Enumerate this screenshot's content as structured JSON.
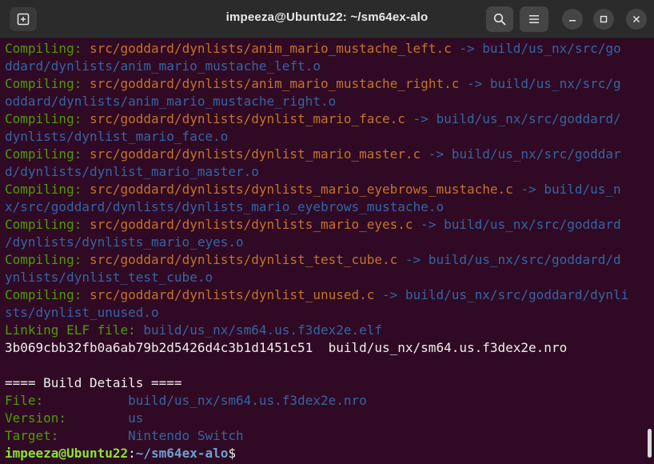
{
  "window": {
    "title": "impeeza@Ubuntu22: ~/sm64ex-alo",
    "icons": {
      "new_tab": "new-tab-icon",
      "search": "search-icon",
      "menu": "hamburger-menu-icon",
      "minimize": "minimize-icon",
      "maximize": "maximize-icon",
      "close": "close-icon"
    }
  },
  "colors": {
    "background": "#300a24",
    "green": "#4e9a06",
    "orange": "#c4732a",
    "blue": "#3465a4",
    "text": "#eeeeec"
  },
  "compile": {
    "label": "Compiling: ",
    "arrow": " -> "
  },
  "lines": {
    "l1": {
      "src": "src/goddard/dynlists/anim_mario_mustache_left.c",
      "dst_a": "build/us_nx/src/go",
      "dst_b": "ddard/dynlists/anim_mario_mustache_left.o"
    },
    "l2": {
      "src": "src/goddard/dynlists/anim_mario_mustache_right.c",
      "dst_a": "build/us_nx/src/g",
      "dst_b": "oddard/dynlists/anim_mario_mustache_right.o"
    },
    "l3": {
      "src": "src/goddard/dynlists/dynlist_mario_face.c",
      "dst_a": "build/us_nx/src/goddard/",
      "dst_b": "dynlists/dynlist_mario_face.o"
    },
    "l4": {
      "src": "src/goddard/dynlists/dynlist_mario_master.c",
      "dst_a": "build/us_nx/src/goddar",
      "dst_b": "d/dynlists/dynlist_mario_master.o"
    },
    "l5": {
      "src": "src/goddard/dynlists/dynlists_mario_eyebrows_mustache.c",
      "dst_a": "build/us_n",
      "dst_b": "x/src/goddard/dynlists/dynlists_mario_eyebrows_mustache.o"
    },
    "l6": {
      "src": "src/goddard/dynlists/dynlists_mario_eyes.c",
      "dst_a": "build/us_nx/src/goddard",
      "dst_b": "/dynlists/dynlists_mario_eyes.o"
    },
    "l7": {
      "src": "src/goddard/dynlists/dynlist_test_cube.c",
      "dst_a": "build/us_nx/src/goddard/d",
      "dst_b": "ynlists/dynlist_test_cube.o"
    },
    "l8": {
      "src": "src/goddard/dynlists/dynlist_unused.c",
      "dst_a": "build/us_nx/src/goddard/dynli",
      "dst_b": "sts/dynlist_unused.o"
    }
  },
  "linking": {
    "label": "Linking ELF file: ",
    "path": "build/us_nx/sm64.us.f3dex2e.elf"
  },
  "hash_line": "3b069cbb32fb0a6ab79b2d5426d4c3b1d1451c51  build/us_nx/sm64.us.f3dex2e.nro",
  "details": {
    "header": "==== Build Details ====",
    "file_label": "File:           ",
    "file_value": "build/us_nx/sm64.us.f3dex2e.nro",
    "version_label": "Version:        ",
    "version_value": "us",
    "target_label": "Target:         ",
    "target_value": "Nintendo Switch"
  },
  "prompt": {
    "user": "impeeza@Ubuntu22",
    "sep": ":",
    "path": "~/sm64ex-alo",
    "symbol": "$"
  }
}
